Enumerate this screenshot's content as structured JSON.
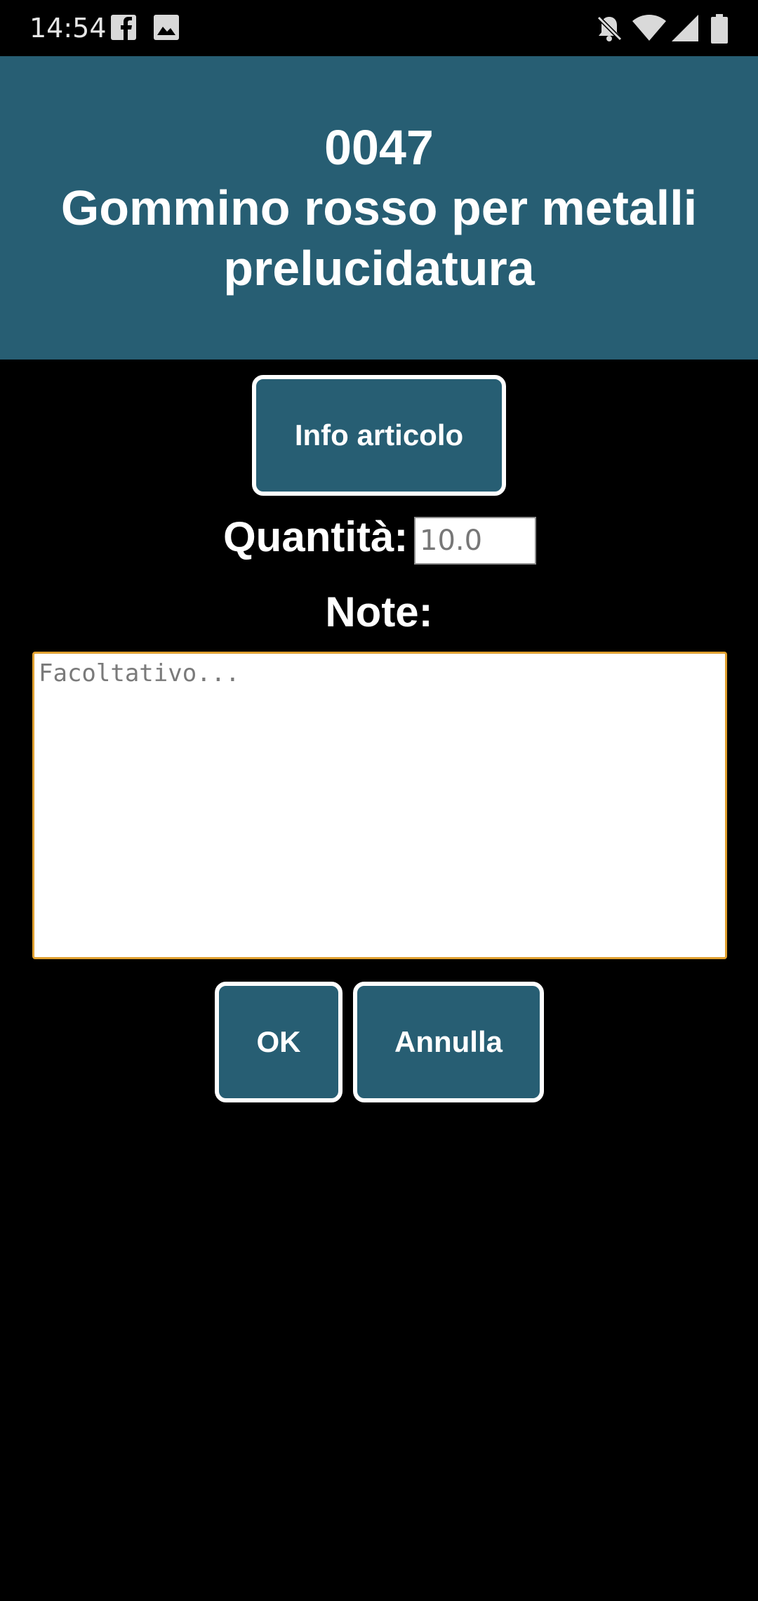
{
  "status_bar": {
    "time": "14:54",
    "icons": [
      "facebook-icon",
      "image-icon",
      "notifications-off-icon",
      "wifi-icon",
      "signal-icon",
      "battery-icon"
    ]
  },
  "header": {
    "code": "0047",
    "name": "Gommino rosso per metalli prelucidatura",
    "background": "#275e73"
  },
  "info_button": {
    "label": "Info articolo"
  },
  "quantity": {
    "label": "Quantità:",
    "placeholder": "10.0"
  },
  "notes": {
    "label": "Note:",
    "placeholder": "Facoltativo..."
  },
  "actions": {
    "ok_label": "OK",
    "cancel_label": "Annulla"
  },
  "colors": {
    "accent": "#275e73",
    "focus_border": "#e0a030"
  }
}
